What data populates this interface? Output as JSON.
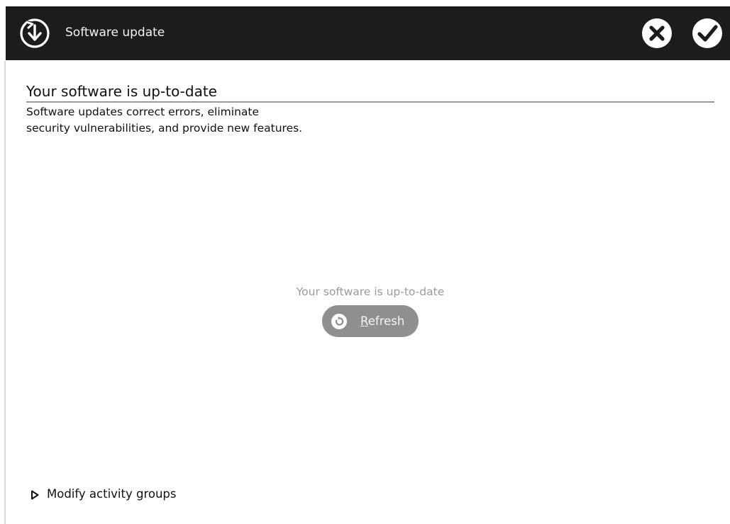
{
  "window": {
    "title": "Software update",
    "app_icon": "download-update-icon",
    "close_icon": "close-circle-icon",
    "confirm_icon": "checkmark-circle-icon"
  },
  "content": {
    "heading": "Your software is up-to-date",
    "description_lines": [
      "Software updates correct errors, eliminate",
      "security vulnerabilities, and provide new features."
    ],
    "status_text": "Your software is up-to-date",
    "refresh_button": {
      "mnemonic": "R",
      "label_rest": "efresh",
      "icon": "refresh-icon"
    },
    "expander": {
      "label": "Modify activity groups",
      "icon": "triangle-right-icon"
    }
  },
  "colors": {
    "titlebar_bg": "#1c1c1c",
    "button_bg": "#8f8f8f",
    "muted_text": "#9a9a9a",
    "text": "#111111"
  }
}
